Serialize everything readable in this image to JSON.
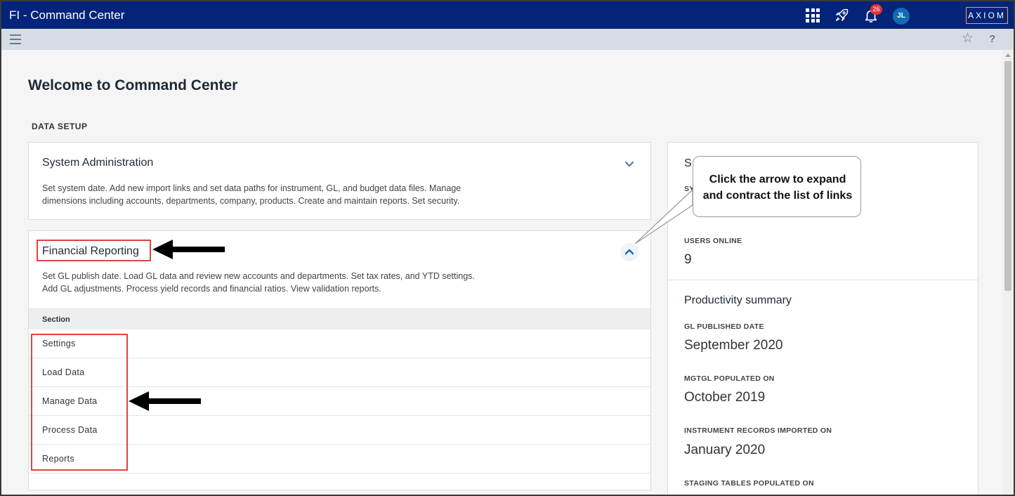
{
  "header": {
    "app_title": "FI - Command Center",
    "notification_count": "26",
    "avatar_initials": "JL",
    "logo_text": "AXIOM"
  },
  "page": {
    "title": "Welcome to Command Center",
    "section_label": "DATA SETUP"
  },
  "cards": {
    "system_administration": {
      "title": "System Administration",
      "desc_line1": "Set system date. Add new import links and set data paths for instrument, GL, and budget data files. Manage",
      "desc_line2": "dimensions including accounts, departments, company, products. Create and maintain reports. Set security."
    },
    "financial_reporting": {
      "title": "Financial Reporting",
      "desc_line1": "Set GL publish date. Load GL data and review new accounts and departments. Set tax rates, and YTD settings.",
      "desc_line2": "Add GL adjustments. Process yield records and financial ratios. View validation reports.",
      "links_header": "Section",
      "links": [
        "Settings",
        "Load Data",
        "Manage Data",
        "Process Data",
        "Reports"
      ]
    }
  },
  "right_panel": {
    "heading_fragment": "S",
    "label_fragment": "SY",
    "users_online_label": "USERS ONLINE",
    "users_online_value": "9",
    "productivity_heading": "Productivity summary",
    "gl_published_label": "GL PUBLISHED DATE",
    "gl_published_value": "September 2020",
    "mgtgl_label": "MGTGL POPULATED ON",
    "mgtgl_value": "October 2019",
    "instrument_label": "INSTRUMENT RECORDS IMPORTED ON",
    "instrument_value": "January 2020",
    "staging_label": "STAGING TABLES POPULATED ON"
  },
  "annotations": {
    "callout_line1": "Click the arrow to expand",
    "callout_line2": "and contract the list of links"
  },
  "colors": {
    "header_bg": "#04247a",
    "accent": "#0f6eb3",
    "annotation_red": "#e0443e",
    "badge_red": "#e0343a"
  }
}
